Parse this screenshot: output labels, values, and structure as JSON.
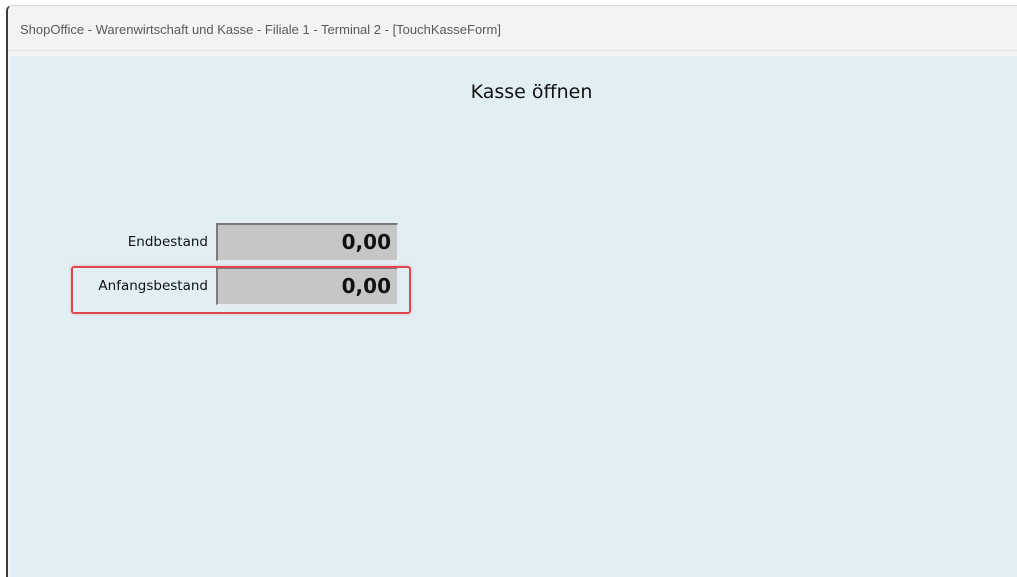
{
  "window": {
    "title": "ShopOffice - Warenwirtschaft und Kasse - Filiale 1 - Terminal 2 - [TouchKasseForm]"
  },
  "form": {
    "heading": "Kasse öffnen",
    "fields": [
      {
        "label": "Endbestand",
        "value": "0,00"
      },
      {
        "label": "Anfangsbestand",
        "value": "0,00"
      }
    ]
  },
  "colors": {
    "client_background": "#e1eff5",
    "field_background": "#c6c6c6",
    "highlight": "#e0474c"
  }
}
